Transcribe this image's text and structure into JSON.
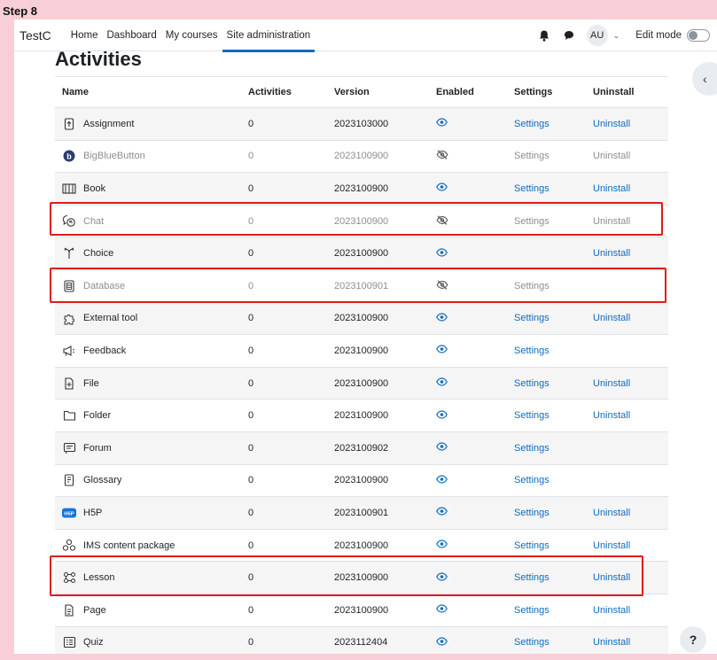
{
  "step_label": "Step 8",
  "navbar": {
    "brand": "TestC",
    "links": [
      "Home",
      "Dashboard",
      "My courses",
      "Site administration"
    ],
    "avatar": "AU",
    "edit_mode_label": "Edit mode"
  },
  "page_heading": "Activities",
  "table": {
    "headers": [
      "Name",
      "Activities",
      "Version",
      "Enabled",
      "Settings",
      "Uninstall"
    ],
    "rows": [
      {
        "icon": "assignment-icon",
        "name": "Assignment",
        "activities": "0",
        "version": "2023103000",
        "enabled": true,
        "settings": "Settings",
        "uninstall": "Uninstall"
      },
      {
        "icon": "bigbluebutton-icon",
        "name": "BigBlueButton",
        "activities": "0",
        "version": "2023100900",
        "enabled": false,
        "settings": "Settings",
        "uninstall": "Uninstall"
      },
      {
        "icon": "book-icon",
        "name": "Book",
        "activities": "0",
        "version": "2023100900",
        "enabled": true,
        "settings": "Settings",
        "uninstall": "Uninstall"
      },
      {
        "icon": "chat-icon",
        "name": "Chat",
        "activities": "0",
        "version": "2023100900",
        "enabled": false,
        "settings": "Settings",
        "uninstall": "Uninstall"
      },
      {
        "icon": "choice-icon",
        "name": "Choice",
        "activities": "0",
        "version": "2023100900",
        "enabled": true,
        "settings": "",
        "uninstall": "Uninstall"
      },
      {
        "icon": "database-icon",
        "name": "Database",
        "activities": "0",
        "version": "2023100901",
        "enabled": false,
        "settings": "Settings",
        "uninstall": ""
      },
      {
        "icon": "puzzle-icon",
        "name": "External tool",
        "activities": "0",
        "version": "2023100900",
        "enabled": true,
        "settings": "Settings",
        "uninstall": "Uninstall"
      },
      {
        "icon": "megaphone-icon",
        "name": "Feedback",
        "activities": "0",
        "version": "2023100900",
        "enabled": true,
        "settings": "Settings",
        "uninstall": ""
      },
      {
        "icon": "file-icon",
        "name": "File",
        "activities": "0",
        "version": "2023100900",
        "enabled": true,
        "settings": "Settings",
        "uninstall": "Uninstall"
      },
      {
        "icon": "folder-icon",
        "name": "Folder",
        "activities": "0",
        "version": "2023100900",
        "enabled": true,
        "settings": "Settings",
        "uninstall": "Uninstall"
      },
      {
        "icon": "forum-icon",
        "name": "Forum",
        "activities": "0",
        "version": "2023100902",
        "enabled": true,
        "settings": "Settings",
        "uninstall": ""
      },
      {
        "icon": "glossary-icon",
        "name": "Glossary",
        "activities": "0",
        "version": "2023100900",
        "enabled": true,
        "settings": "Settings",
        "uninstall": ""
      },
      {
        "icon": "h5p-icon",
        "name": "H5P",
        "activities": "0",
        "version": "2023100901",
        "enabled": true,
        "settings": "Settings",
        "uninstall": "Uninstall"
      },
      {
        "icon": "package-icon",
        "name": "IMS content package",
        "activities": "0",
        "version": "2023100900",
        "enabled": true,
        "settings": "Settings",
        "uninstall": "Uninstall"
      },
      {
        "icon": "lesson-icon",
        "name": "Lesson",
        "activities": "0",
        "version": "2023100900",
        "enabled": true,
        "settings": "Settings",
        "uninstall": "Uninstall"
      },
      {
        "icon": "page-icon",
        "name": "Page",
        "activities": "0",
        "version": "2023100900",
        "enabled": true,
        "settings": "Settings",
        "uninstall": "Uninstall"
      },
      {
        "icon": "quiz-icon",
        "name": "Quiz",
        "activities": "0",
        "version": "2023112404",
        "enabled": true,
        "settings": "Settings",
        "uninstall": "Uninstall"
      }
    ]
  },
  "help_label": "?",
  "colors": {
    "link": "#0f6cbf",
    "highlight": "#e01a1a",
    "background": "#f8cfd6",
    "dim": "#8a8f94"
  }
}
